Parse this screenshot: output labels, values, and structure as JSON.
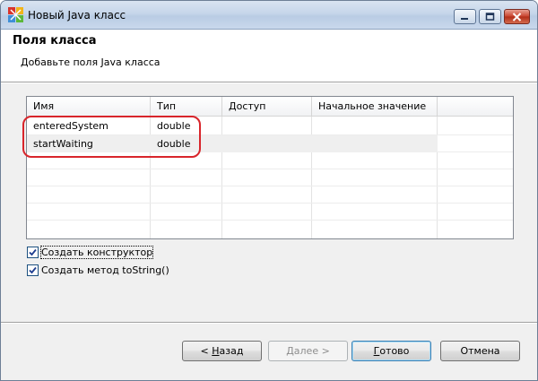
{
  "window": {
    "title": "Новый Java класс"
  },
  "header": {
    "title": "Поля класса",
    "description": "Добавьте поля Java класса"
  },
  "table": {
    "columns": [
      "Имя",
      "Тип",
      "Доступ",
      "Начальное значение"
    ],
    "rows": [
      {
        "name": "enteredSystem",
        "type": "double",
        "access": "",
        "initial": ""
      },
      {
        "name": "startWaiting",
        "type": "double",
        "access": "",
        "initial": ""
      }
    ]
  },
  "options": {
    "create_constructor": {
      "label": "Создать конструктор",
      "checked": true
    },
    "create_tostring": {
      "label": "Создать метод toString()",
      "checked": true
    }
  },
  "buttons": {
    "back": {
      "mnemonic": "Н",
      "rest": "азад",
      "prefix": "< "
    },
    "next": {
      "mnemonic": "Д",
      "rest": "алее",
      "suffix": " >"
    },
    "finish": {
      "mnemonic": "Г",
      "rest": "отово"
    },
    "cancel": {
      "label": "Отмена"
    }
  },
  "colors": {
    "highlight": "#d8252b",
    "selected_row": "#efefef"
  }
}
